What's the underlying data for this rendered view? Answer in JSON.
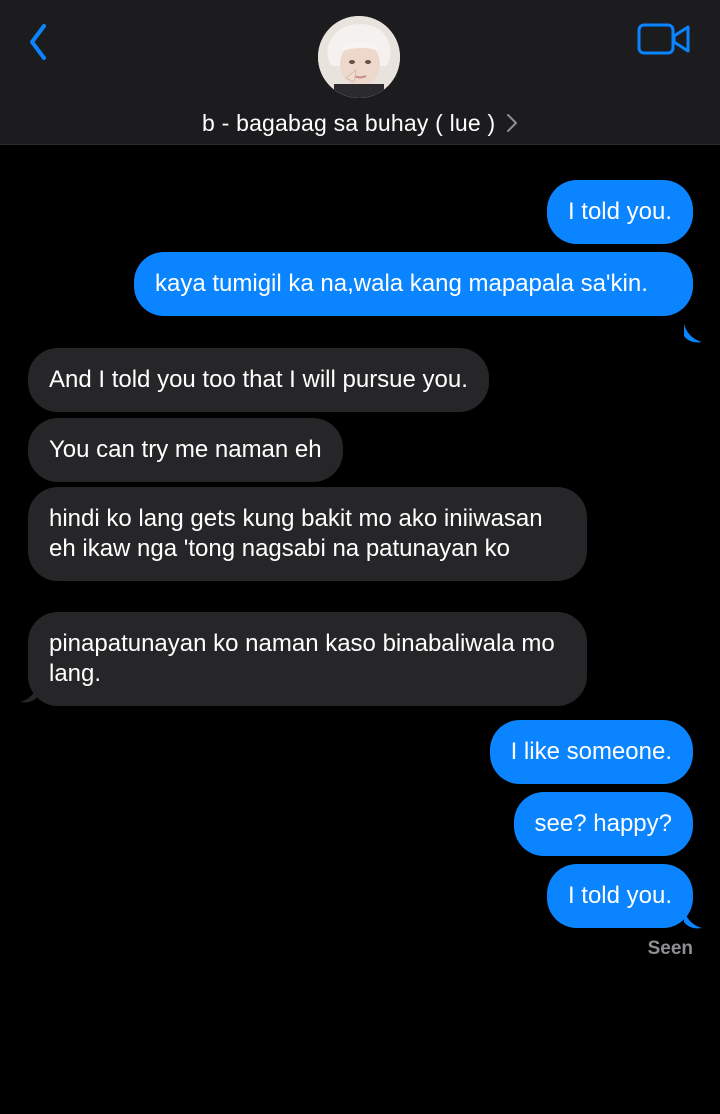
{
  "header": {
    "contact_name": "b - bagabag sa buhay ( lue )",
    "back_icon": "chevron-left-icon",
    "video_icon": "video-camera-icon",
    "accent_color": "#0a84ff"
  },
  "messages": [
    {
      "side": "sent",
      "text": "I told you."
    },
    {
      "side": "sent",
      "text": "kaya tumigil ka na,wala kang mapapala sa'kin."
    },
    {
      "side": "received",
      "text": "And I told you too that I will pursue you."
    },
    {
      "side": "received",
      "text": "You can try me naman eh"
    },
    {
      "side": "received",
      "text": "hindi ko lang gets kung bakit mo ako iniiwasan eh ikaw nga 'tong nagsabi na patunayan ko"
    },
    {
      "side": "received",
      "text": "pinapatunayan ko naman kaso binabaliwala mo lang."
    },
    {
      "side": "sent",
      "text": "I like someone."
    },
    {
      "side": "sent",
      "text": "see? happy?"
    },
    {
      "side": "sent",
      "text": "I told you."
    }
  ],
  "status": {
    "read_receipt": "Seen"
  }
}
